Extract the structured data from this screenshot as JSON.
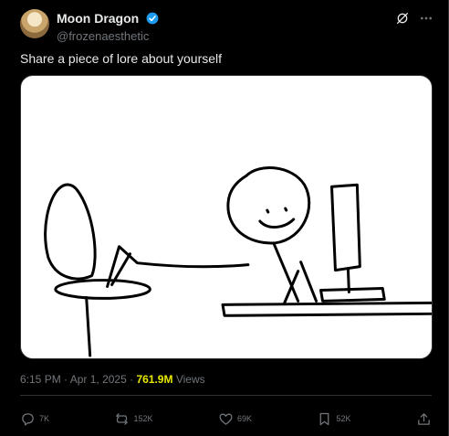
{
  "author": {
    "display_name": "Moon Dragon",
    "handle": "@frozenaesthetic"
  },
  "post": {
    "text": "Share a piece of lore about yourself"
  },
  "meta": {
    "time": "6:15 PM",
    "separator": "·",
    "date": "Apr 1, 2025",
    "views_count": "761.9M",
    "views_label": "Views"
  },
  "actions": {
    "replies": "7K",
    "reposts": "152K",
    "likes": "69K",
    "bookmarks": "52K"
  },
  "icons": {
    "verified": "verified-badge-icon",
    "grok": "grok-icon",
    "more": "more-icon",
    "reply": "reply-icon",
    "repost": "repost-icon",
    "like": "like-icon",
    "bookmark": "bookmark-icon",
    "share": "share-icon"
  },
  "colors": {
    "background": "#000000",
    "text": "#e7e9ea",
    "muted": "#71767b",
    "verified": "#1d9bf0",
    "views_highlight": "#e8e800"
  }
}
